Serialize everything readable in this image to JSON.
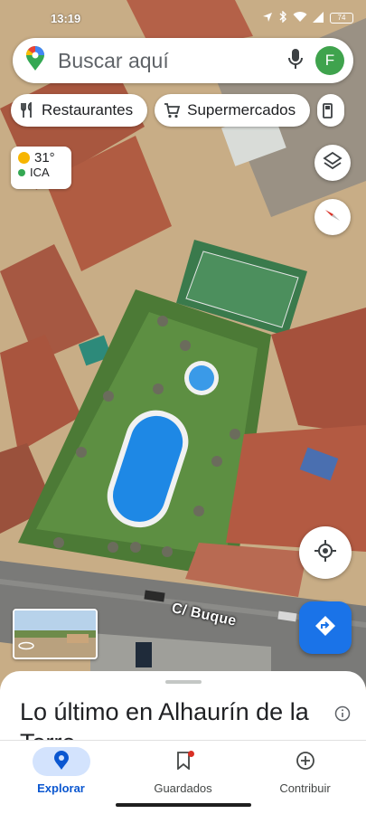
{
  "status_bar": {
    "time": "13:19",
    "battery": "74"
  },
  "search": {
    "placeholder": "Buscar aquí",
    "avatar_initial": "F"
  },
  "chips": [
    {
      "label": "Restaurantes",
      "icon": "fork-knife-icon"
    },
    {
      "label": "Supermercados",
      "icon": "shopping-cart-icon"
    },
    {
      "label": "",
      "icon": "gas-station-icon"
    }
  ],
  "weather": {
    "temp": "31°",
    "aqi": "ICA"
  },
  "map": {
    "street_name": "C/ Buque"
  },
  "sheet": {
    "title": "Lo último en Alhaurín de la Torre"
  },
  "nav": [
    {
      "label": "Explorar",
      "icon": "pin-icon",
      "active": true
    },
    {
      "label": "Guardados",
      "icon": "bookmark-icon",
      "active": false
    },
    {
      "label": "Contribuir",
      "icon": "add-circle-icon",
      "active": false
    }
  ],
  "colors": {
    "accent": "#1a73e8",
    "active_nav": "#d3e3fd",
    "avatar": "#3fa34d"
  }
}
